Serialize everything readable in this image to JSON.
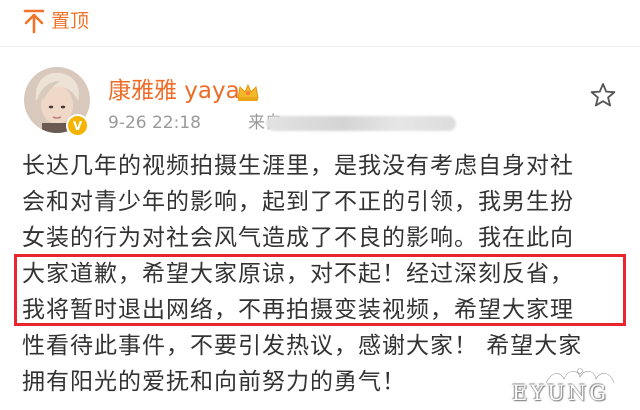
{
  "header": {
    "pin_label": "置顶"
  },
  "post": {
    "author_name": "康雅雅 yaya",
    "time": "9-26 22:18",
    "source_prefix": "来自",
    "body_lines": [
      "长达几年的视频拍摄生涯里，是我没有考虑自身对社",
      "会和对青少年的影响，起到了不正的引领，我男生扮",
      "女装的行为对社会风气造成了不良的影响。我在此向",
      "大家道歉，希望大家原谅，对不起！经过深刻反省，",
      "我将暂时退出网络，不再拍摄变装视频，希望大家理",
      "性看待此事件，不要引发热议，感谢大家！ 希望大家",
      "拥有阳光的爱抚和向前努力的勇气！"
    ]
  },
  "watermark": {
    "text": "EYUNG"
  },
  "colors": {
    "accent_orange": "#f2742a",
    "highlight_red": "#e8262f",
    "verify_gold": "#f4b400"
  },
  "icons": {
    "pin": "pin-top-icon",
    "crown": "crown-icon",
    "favorite": "star-icon",
    "verified": "verified-badge-icon"
  }
}
